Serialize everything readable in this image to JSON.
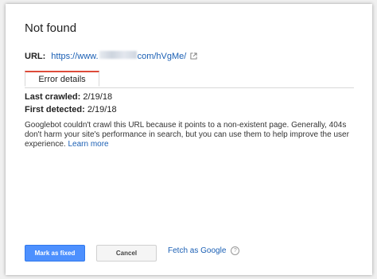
{
  "dialog": {
    "title": "Not found",
    "url_label": "URL:",
    "url_prefix": "https://www.",
    "url_suffix": "com/hVgMe/",
    "tabs": [
      {
        "label": "Error details"
      }
    ],
    "last_crawled_label": "Last crawled:",
    "last_crawled_value": "2/19/18",
    "first_detected_label": "First detected:",
    "first_detected_value": "2/19/18",
    "description": "Googlebot couldn't crawl this URL because it points to a non-existent page. Generally, 404s don't harm your site's performance in search, but you can use them to help improve the user experience.",
    "learn_more": "Learn more",
    "mark_fixed_button": "Mark as fixed",
    "cancel_button": "Cancel",
    "fetch_as_google": "Fetch as Google",
    "help_glyph": "?"
  },
  "colors": {
    "accent": "#4d90fe",
    "link": "#1a5fb4",
    "tab_highlight": "#dd4b39"
  },
  "icons": {
    "external": "external-link-icon",
    "help": "help-icon"
  }
}
